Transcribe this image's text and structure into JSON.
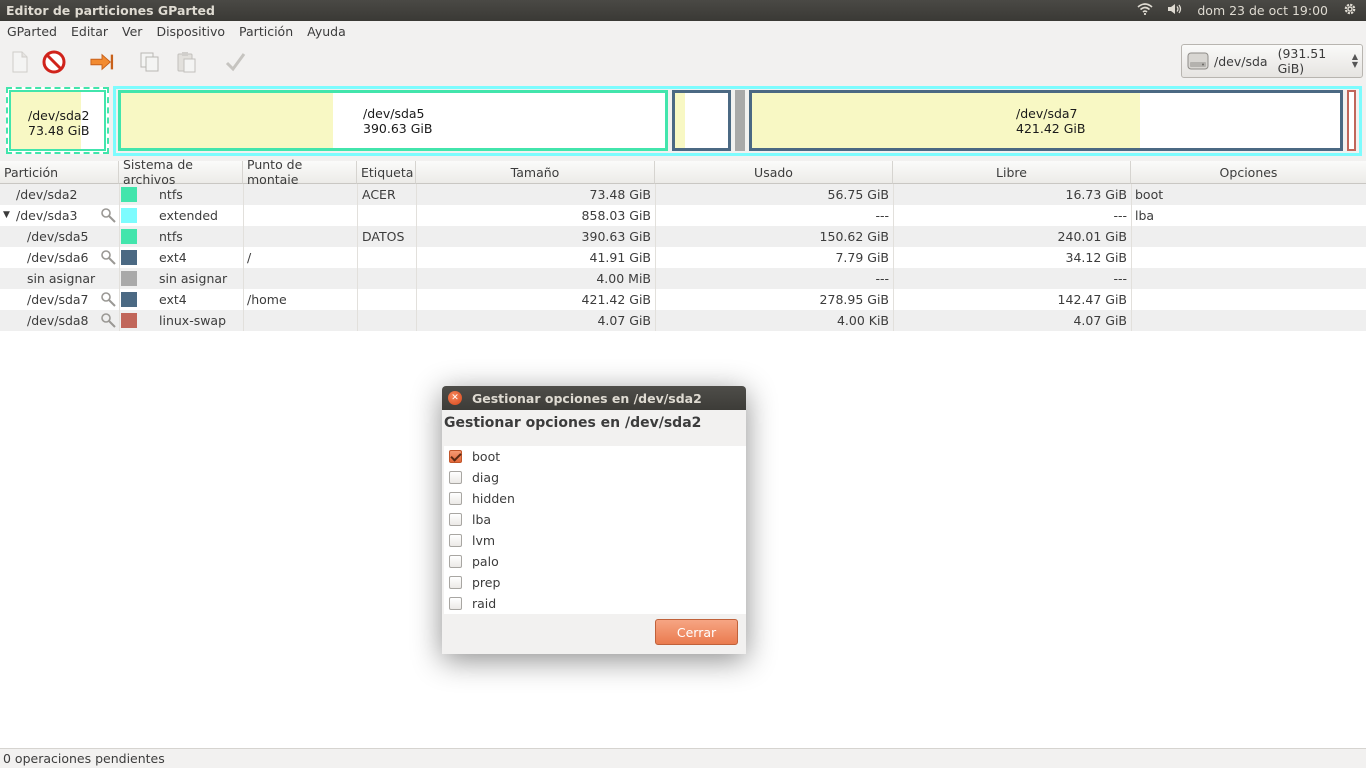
{
  "window": {
    "title": "Editor de particiones GParted"
  },
  "top_panel": {
    "datetime": "dom 23 de oct 19:00",
    "wifi_icon": "wifi-icon",
    "volume_icon": "volume-icon",
    "gear_icon": "gear-icon"
  },
  "menu": [
    "GParted",
    "Editar",
    "Ver",
    "Dispositivo",
    "Partición",
    "Ayuda"
  ],
  "toolbar": {
    "icons": [
      "new-partition-icon",
      "delete-icon",
      "resize-move-icon",
      "copy-icon",
      "paste-icon",
      "apply-icon"
    ]
  },
  "device": {
    "name": "/dev/sda",
    "size": "(931.51 GiB)"
  },
  "diskmap": {
    "sda2": {
      "name": "/dev/sda2",
      "size": "73.48 GiB",
      "used_fraction": 0.77
    },
    "sda5": {
      "name": "/dev/sda5",
      "size": "390.63 GiB",
      "used_fraction": 0.39
    },
    "sda6": {
      "used_fraction": 0.19
    },
    "sda7": {
      "name": "/dev/sda7",
      "size": "421.42 GiB",
      "used_fraction": 0.66
    }
  },
  "table": {
    "columns": [
      "Partición",
      "Sistema de archivos",
      "Punto de montaje",
      "Etiqueta",
      "Tamaño",
      "Usado",
      "Libre",
      "Opciones"
    ],
    "rows": [
      {
        "partition": "/dev/sda2",
        "fs": "ntfs",
        "mount": "",
        "label": "ACER",
        "size": "73.48 GiB",
        "used": "56.75 GiB",
        "free": "16.73 GiB",
        "flags": "boot",
        "color": "#42e5ac",
        "key": false,
        "indent": false,
        "expander": false
      },
      {
        "partition": "/dev/sda3",
        "fs": "extended",
        "mount": "",
        "label": "",
        "size": "858.03 GiB",
        "used": "---",
        "free": "---",
        "flags": "lba",
        "color": "#7dfcfe",
        "key": true,
        "indent": false,
        "expander": true
      },
      {
        "partition": "/dev/sda5",
        "fs": "ntfs",
        "mount": "",
        "label": "DATOS",
        "size": "390.63 GiB",
        "used": "150.62 GiB",
        "free": "240.01 GiB",
        "flags": "",
        "color": "#42e5ac",
        "key": false,
        "indent": true,
        "expander": false
      },
      {
        "partition": "/dev/sda6",
        "fs": "ext4",
        "mount": "/",
        "label": "",
        "size": "41.91 GiB",
        "used": "7.79 GiB",
        "free": "34.12 GiB",
        "flags": "",
        "color": "#4b6983",
        "key": true,
        "indent": true,
        "expander": false
      },
      {
        "partition": "sin asignar",
        "fs": "sin asignar",
        "mount": "",
        "label": "",
        "size": "4.00 MiB",
        "used": "---",
        "free": "---",
        "flags": "",
        "color": "#a9a9a9",
        "key": false,
        "indent": true,
        "expander": false
      },
      {
        "partition": "/dev/sda7",
        "fs": "ext4",
        "mount": "/home",
        "label": "",
        "size": "421.42 GiB",
        "used": "278.95 GiB",
        "free": "142.47 GiB",
        "flags": "",
        "color": "#4b6983",
        "key": true,
        "indent": true,
        "expander": false
      },
      {
        "partition": "/dev/sda8",
        "fs": "linux-swap",
        "mount": "",
        "label": "",
        "size": "4.07 GiB",
        "used": "4.00 KiB",
        "free": "4.07 GiB",
        "flags": "",
        "color": "#c1665a",
        "key": true,
        "indent": true,
        "expander": false
      }
    ]
  },
  "status": {
    "text": "0 operaciones pendientes"
  },
  "dialog": {
    "title": "Gestionar opciones en /dev/sda2",
    "heading": "Gestionar opciones en /dev/sda2",
    "flags": [
      {
        "name": "boot",
        "checked": true
      },
      {
        "name": "diag",
        "checked": false
      },
      {
        "name": "hidden",
        "checked": false
      },
      {
        "name": "lba",
        "checked": false
      },
      {
        "name": "lvm",
        "checked": false
      },
      {
        "name": "palo",
        "checked": false
      },
      {
        "name": "prep",
        "checked": false
      },
      {
        "name": "raid",
        "checked": false
      }
    ],
    "close_label": "Cerrar"
  },
  "colors": {
    "ntfs": "#42e5ac",
    "extended": "#7dfcfe",
    "ext4": "#4b6983",
    "unallocated": "#a9a9a9",
    "linux_swap": "#c1665a",
    "used_fill": "#f8f8c4",
    "accent": "#e96f3f"
  }
}
